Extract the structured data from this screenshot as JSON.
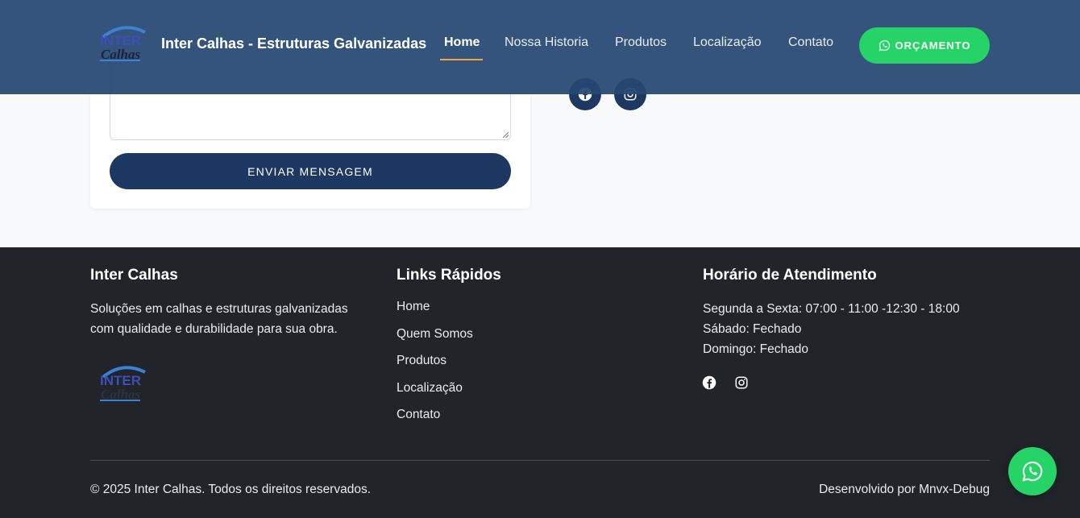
{
  "navbar": {
    "brand": "Inter Calhas - Estruturas Galvanizadas",
    "logo_icon": "inter-calhas-logo",
    "links": [
      {
        "label": "Home",
        "active": true
      },
      {
        "label": "Nossa Historia",
        "active": false
      },
      {
        "label": "Produtos",
        "active": false
      },
      {
        "label": "Localização",
        "active": false
      },
      {
        "label": "Contato",
        "active": false
      }
    ],
    "quote_button": {
      "label": "ORÇAMENTO",
      "icon": "whatsapp-icon"
    }
  },
  "contact_form": {
    "submit_label": "ENVIAR MENSAGEM"
  },
  "contact_social": {
    "icons": [
      "facebook-icon",
      "instagram-icon"
    ]
  },
  "footer": {
    "about": {
      "title": "Inter Calhas",
      "text": "Soluções em calhas e estruturas galvanizadas com qualidade e durabilidade para sua obra."
    },
    "links": {
      "title": "Links Rápidos",
      "items": [
        "Home",
        "Quem Somos",
        "Produtos",
        "Localização",
        "Contato"
      ]
    },
    "hours": {
      "title": "Horário de Atendimento",
      "lines": [
        "Segunda a Sexta: 07:00 - 11:00 -12:30 - 18:00",
        "Sábado: Fechado",
        "Domingo: Fechado"
      ]
    },
    "copyright": "© 2025 Inter Calhas. Todos os direitos reservados.",
    "credit": "Desenvolvido por Mnvx-Debug"
  },
  "colors": {
    "navbar_bg": "#264771",
    "accent_green": "#25d366",
    "primary_navy": "#1d3962",
    "footer_bg": "#212529",
    "active_underline": "#f0a640"
  }
}
